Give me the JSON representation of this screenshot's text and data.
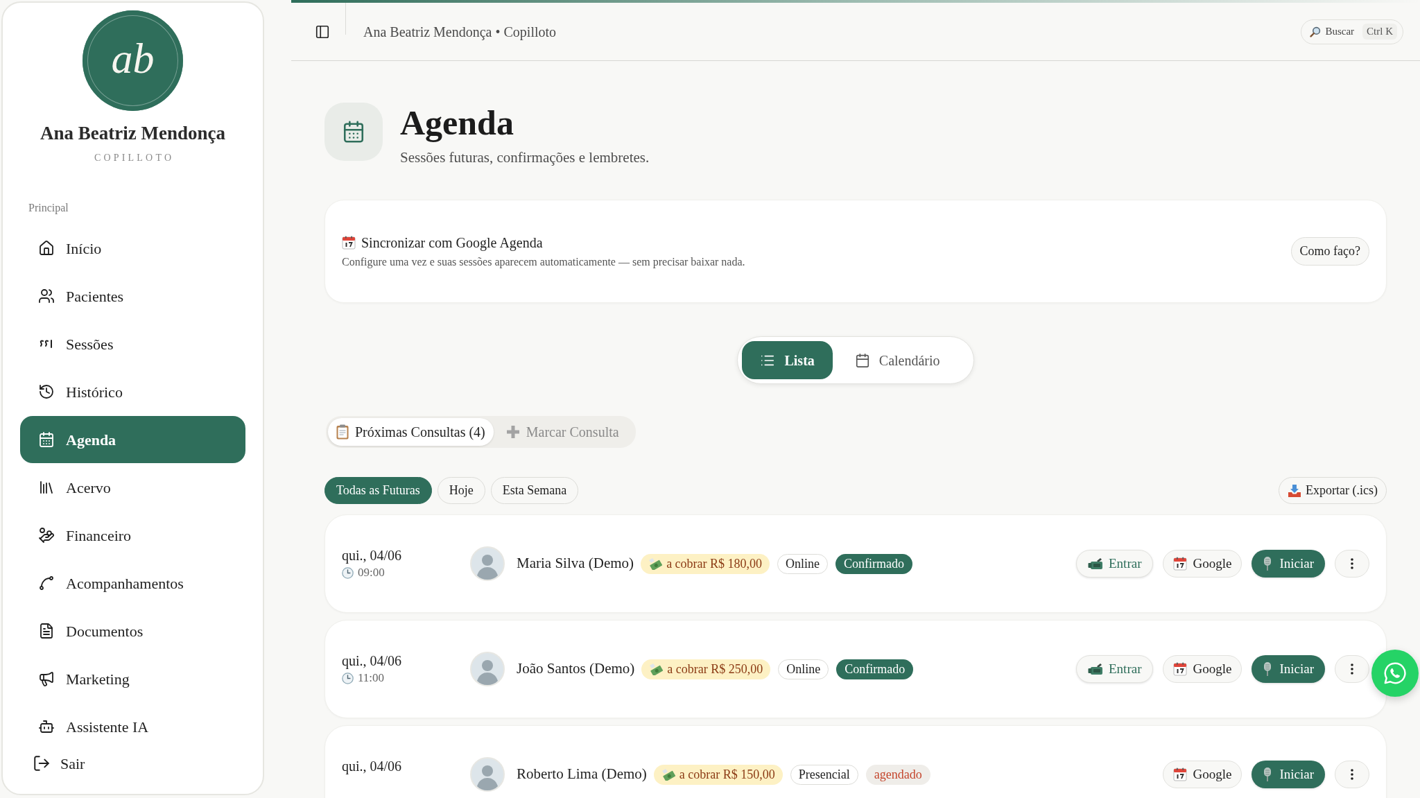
{
  "sidebar": {
    "logo_text": "ab",
    "user_name": "Ana Beatriz Mendonça",
    "role": "COPILLOTO",
    "section_label": "Principal",
    "items": [
      {
        "label": "Início",
        "selected": false
      },
      {
        "label": "Pacientes",
        "selected": false
      },
      {
        "label": "Sessões",
        "selected": false
      },
      {
        "label": "Histórico",
        "selected": false
      },
      {
        "label": "Agenda",
        "selected": true
      },
      {
        "label": "Acervo",
        "selected": false
      },
      {
        "label": "Financeiro",
        "selected": false
      },
      {
        "label": "Acompanhamentos",
        "selected": false
      },
      {
        "label": "Documentos",
        "selected": false
      },
      {
        "label": "Marketing",
        "selected": false
      },
      {
        "label": "Assistente IA",
        "selected": false
      }
    ],
    "logout": "Sair"
  },
  "header": {
    "breadcrumb": "Ana Beatriz Mendonça • Copilloto",
    "search": {
      "label": "Buscar",
      "shortcut": "Ctrl K"
    }
  },
  "page": {
    "title": "Agenda",
    "subtitle": "Sessões futuras, confirmações e lembretes."
  },
  "sync_card": {
    "title": "Sincronizar com Google Agenda",
    "description": "Configure uma vez e suas sessões aparecem automaticamente — sem precisar baixar nada.",
    "button": "Como faço?"
  },
  "view_toggle": [
    {
      "label": "Lista",
      "selected": true
    },
    {
      "label": "Calendário",
      "selected": false
    }
  ],
  "tabs": [
    {
      "label": "Próximas Consultas (4)",
      "selected": true
    },
    {
      "label": "Marcar Consulta",
      "selected": false
    }
  ],
  "filters": [
    {
      "label": "Todas as Futuras",
      "selected": true
    },
    {
      "label": "Hoje",
      "selected": false
    },
    {
      "label": "Esta Semana",
      "selected": false
    }
  ],
  "export_button": "Exportar (.ics)",
  "appointments": [
    {
      "date": "qui., 04/06",
      "time": "09:00",
      "patient": "Maria Silva (Demo)",
      "charge": "a cobrar R$ 180,00",
      "mode": "Online",
      "status": {
        "label": "Confirmado",
        "kind": "confirmed"
      },
      "actions": [
        {
          "kind": "join",
          "label": "Entrar"
        },
        {
          "kind": "google",
          "label": "Google"
        },
        {
          "kind": "start",
          "label": "Iniciar"
        },
        {
          "kind": "more"
        }
      ]
    },
    {
      "date": "qui., 04/06",
      "time": "11:00",
      "patient": "João Santos (Demo)",
      "charge": "a cobrar R$ 250,00",
      "mode": "Online",
      "status": {
        "label": "Confirmado",
        "kind": "confirmed"
      },
      "actions": [
        {
          "kind": "join",
          "label": "Entrar"
        },
        {
          "kind": "google",
          "label": "Google"
        },
        {
          "kind": "start",
          "label": "Iniciar"
        },
        {
          "kind": "more"
        }
      ]
    },
    {
      "date": "qui., 04/06",
      "patient": "Roberto Lima (Demo)",
      "charge": "a cobrar R$ 150,00",
      "mode": "Presencial",
      "status": {
        "label": "agendado",
        "kind": "scheduled"
      },
      "actions": [
        {
          "kind": "google",
          "label": "Google"
        },
        {
          "kind": "start",
          "label": "Iniciar"
        },
        {
          "kind": "more"
        }
      ]
    }
  ]
}
